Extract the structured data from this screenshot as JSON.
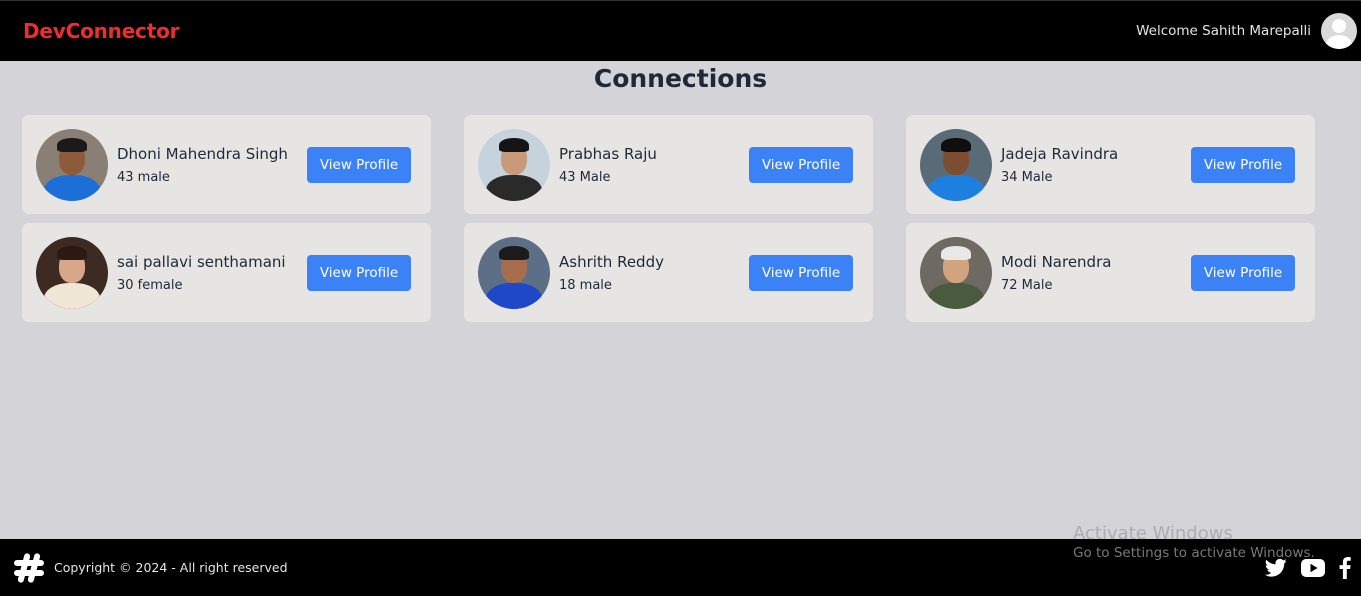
{
  "navbar": {
    "brand": "DevConnector",
    "welcome": "Welcome Sahith Marepalli",
    "avatar_icon": "user-avatar-icon"
  },
  "page": {
    "title": "Connections"
  },
  "connections": [
    {
      "name": "Dhoni Mahendra Singh",
      "meta": "43 male",
      "button": "View Profile",
      "photo_bg": "#8a7f74",
      "skin": "#8d5a3b",
      "shirt": "#1d6fd8",
      "hair": "#1a1a1a"
    },
    {
      "name": "Prabhas Raju",
      "meta": "43 Male",
      "button": "View Profile",
      "photo_bg": "#c7d3dc",
      "skin": "#c79a7a",
      "shirt": "#2a2a2a",
      "hair": "#141414"
    },
    {
      "name": "Jadeja Ravindra",
      "meta": "34 Male",
      "button": "View Profile",
      "photo_bg": "#5a6b78",
      "skin": "#7d4d32",
      "shirt": "#1d7fe0",
      "hair": "#0f0f0f"
    },
    {
      "name": "sai pallavi senthamani",
      "meta": "30 female",
      "button": "View Profile",
      "photo_bg": "#3d2a22",
      "skin": "#d8a68a",
      "shirt": "#f0e6d6",
      "hair": "#2b1a14"
    },
    {
      "name": "Ashrith Reddy",
      "meta": "18 male",
      "button": "View Profile",
      "photo_bg": "#5d6f86",
      "skin": "#a56d4e",
      "shirt": "#1f48c9",
      "hair": "#1b1b1b"
    },
    {
      "name": "Modi Narendra",
      "meta": "72 Male",
      "button": "View Profile",
      "photo_bg": "#6e6a62",
      "skin": "#d1a37f",
      "shirt": "#4a5a3e",
      "hair": "#e8e8e8"
    }
  ],
  "footer": {
    "copyright": "Copyright © 2024 - All right reserved",
    "logo_icon": "hash-logo-icon",
    "social_icons": [
      "twitter-icon",
      "youtube-icon",
      "facebook-icon"
    ]
  },
  "watermark": {
    "title": "Activate Windows",
    "subtitle": "Go to Settings to activate Windows."
  },
  "colors": {
    "brand": "#ef2d2d",
    "button": "#3b82f6",
    "background": "#d4d4d8",
    "card": "#e7e5e4"
  }
}
